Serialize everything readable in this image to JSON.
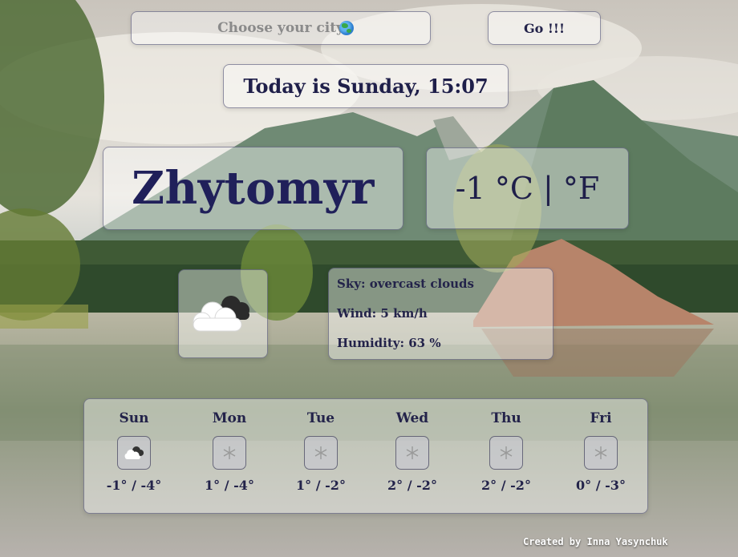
{
  "search": {
    "placeholder": "Choose your city",
    "icon": "globe-icon"
  },
  "go_button": {
    "label": "Go !!!"
  },
  "today": {
    "text": "Today is Sunday, 15:07"
  },
  "current": {
    "city": "Zhytomyr",
    "temperature": "-1 °C | °F",
    "icon": "cloud-overcast-icon",
    "sky": "Sky: overcast clouds",
    "wind": "Wind: 5 km/h",
    "humidity": "Humidity: 63 %"
  },
  "forecast": [
    {
      "day": "Sun",
      "range": "-1° / -4°",
      "icon": "cloud-overcast-icon"
    },
    {
      "day": "Mon",
      "range": "1° / -4°",
      "icon": "snowflake-icon"
    },
    {
      "day": "Tue",
      "range": "1° / -2°",
      "icon": "snowflake-icon"
    },
    {
      "day": "Wed",
      "range": "2° / -2°",
      "icon": "snowflake-icon"
    },
    {
      "day": "Thu",
      "range": "2° / -2°",
      "icon": "snowflake-icon"
    },
    {
      "day": "Fri",
      "range": "0° / -3°",
      "icon": "snowflake-icon"
    }
  ],
  "footer": {
    "credit": "Created by Inna Yasynchuk"
  },
  "colors": {
    "text": "#23234a",
    "panel": "rgba(255,255,255,0.42)",
    "border": "#3c3c64"
  }
}
